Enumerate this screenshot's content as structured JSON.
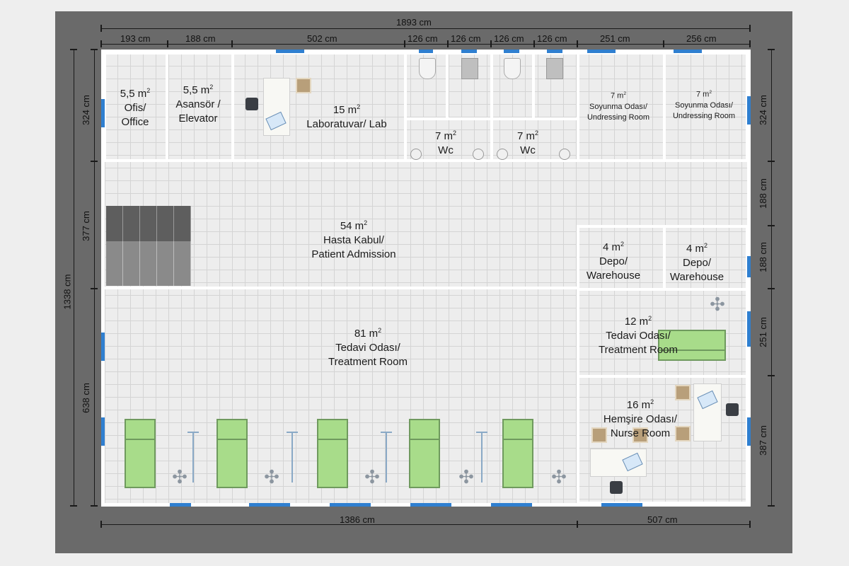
{
  "dimensions": {
    "top_total": "1893 cm",
    "top_segments": [
      "193 cm",
      "188 cm",
      "502 cm",
      "126 cm",
      "126 cm",
      "126 cm",
      "126 cm",
      "251 cm",
      "256 cm"
    ],
    "bottom_left": "1386 cm",
    "bottom_right": "507 cm",
    "left_total": "1338 cm",
    "left_segments": [
      "324 cm",
      "377 cm",
      "638 cm"
    ],
    "right_segments": [
      "324 cm",
      "188 cm",
      "188 cm",
      "251 cm",
      "387 cm"
    ]
  },
  "rooms": {
    "office": {
      "area": "5,5 m",
      "name_tr": "Ofis/",
      "name_en": "Office"
    },
    "elevator": {
      "area": "5,5 m",
      "name_tr": "Asansör /",
      "name_en": "Elevator"
    },
    "lab": {
      "area": "15 m",
      "name": "Laboratuvar/ Lab"
    },
    "wc1": {
      "area": "7 m",
      "name": "Wc"
    },
    "wc2": {
      "area": "7 m",
      "name": "Wc"
    },
    "undress1": {
      "area": "7 m",
      "name_tr": "Soyunma Odası/",
      "name_en": "Undressing Room"
    },
    "undress2": {
      "area": "7 m",
      "name_tr": "Soyunma Odası/",
      "name_en": "Undressing Room"
    },
    "admission": {
      "area": "54 m",
      "name_tr": "Hasta Kabul/",
      "name_en": "Patient Admission"
    },
    "warehouse1": {
      "area": "4 m",
      "name_tr": "Depo/",
      "name_en": "Warehouse"
    },
    "warehouse2": {
      "area": "4 m",
      "name_tr": "Depo/",
      "name_en": "Warehouse"
    },
    "treatment_large": {
      "area": "81 m",
      "name_tr": "Tedavi Odası/",
      "name_en": "Treatment Room"
    },
    "treatment_small": {
      "area": "12 m",
      "name_tr": "Tedavi Odası/",
      "name_en": "Treatment Room"
    },
    "nurse": {
      "area": "16 m",
      "name_tr": "Hemşire Odası/",
      "name_en": "Nurse Room"
    }
  },
  "area_superscript": "2",
  "colors": {
    "window": "#2f7fd0",
    "bed": "#a8dc8a",
    "frame": "#6a6a6a",
    "wall": "#ffffff"
  }
}
